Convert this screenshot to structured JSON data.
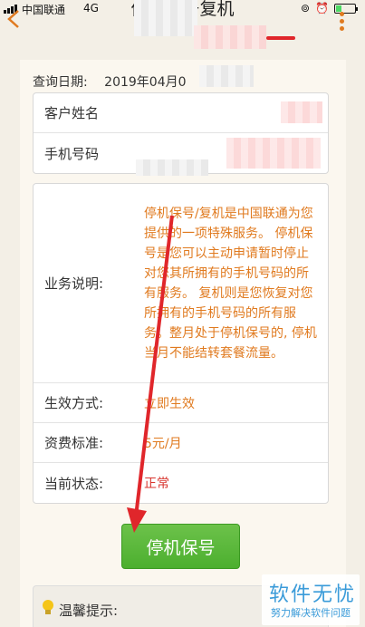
{
  "status_bar": {
    "carrier": "中国联通",
    "network": "4G"
  },
  "nav": {
    "title": "停机保号复机"
  },
  "query": {
    "label": "查询日期:",
    "value": "2019年04月0"
  },
  "customer": {
    "name_label": "客户姓名",
    "phone_label": "手机号码"
  },
  "service": {
    "desc_label": "业务说明:",
    "desc_text": "停机保号/复机是中国联通为您提供的一项特殊服务。 停机保号是您可以主动申请暂时停止对您其所拥有的手机号码的所有服务。 复机则是您恢复对您所拥有的手机号码的所有服务。整月处于停机保号的, 停机当月不能结转套餐流量。",
    "effect_label": "生效方式:",
    "effect_value": "立即生效",
    "fee_label": "资费标准:",
    "fee_value": "5元/月",
    "status_label": "当前状态:",
    "status_value": "正常"
  },
  "action_button": "停机保号",
  "tips": {
    "title": "温馨提示:"
  },
  "watermark": {
    "title": "软件无忧",
    "subtitle": "努力解决软件问题"
  },
  "colors": {
    "accent": "#e07a1f",
    "button": "#5cb83c",
    "status": "#d8362f"
  }
}
